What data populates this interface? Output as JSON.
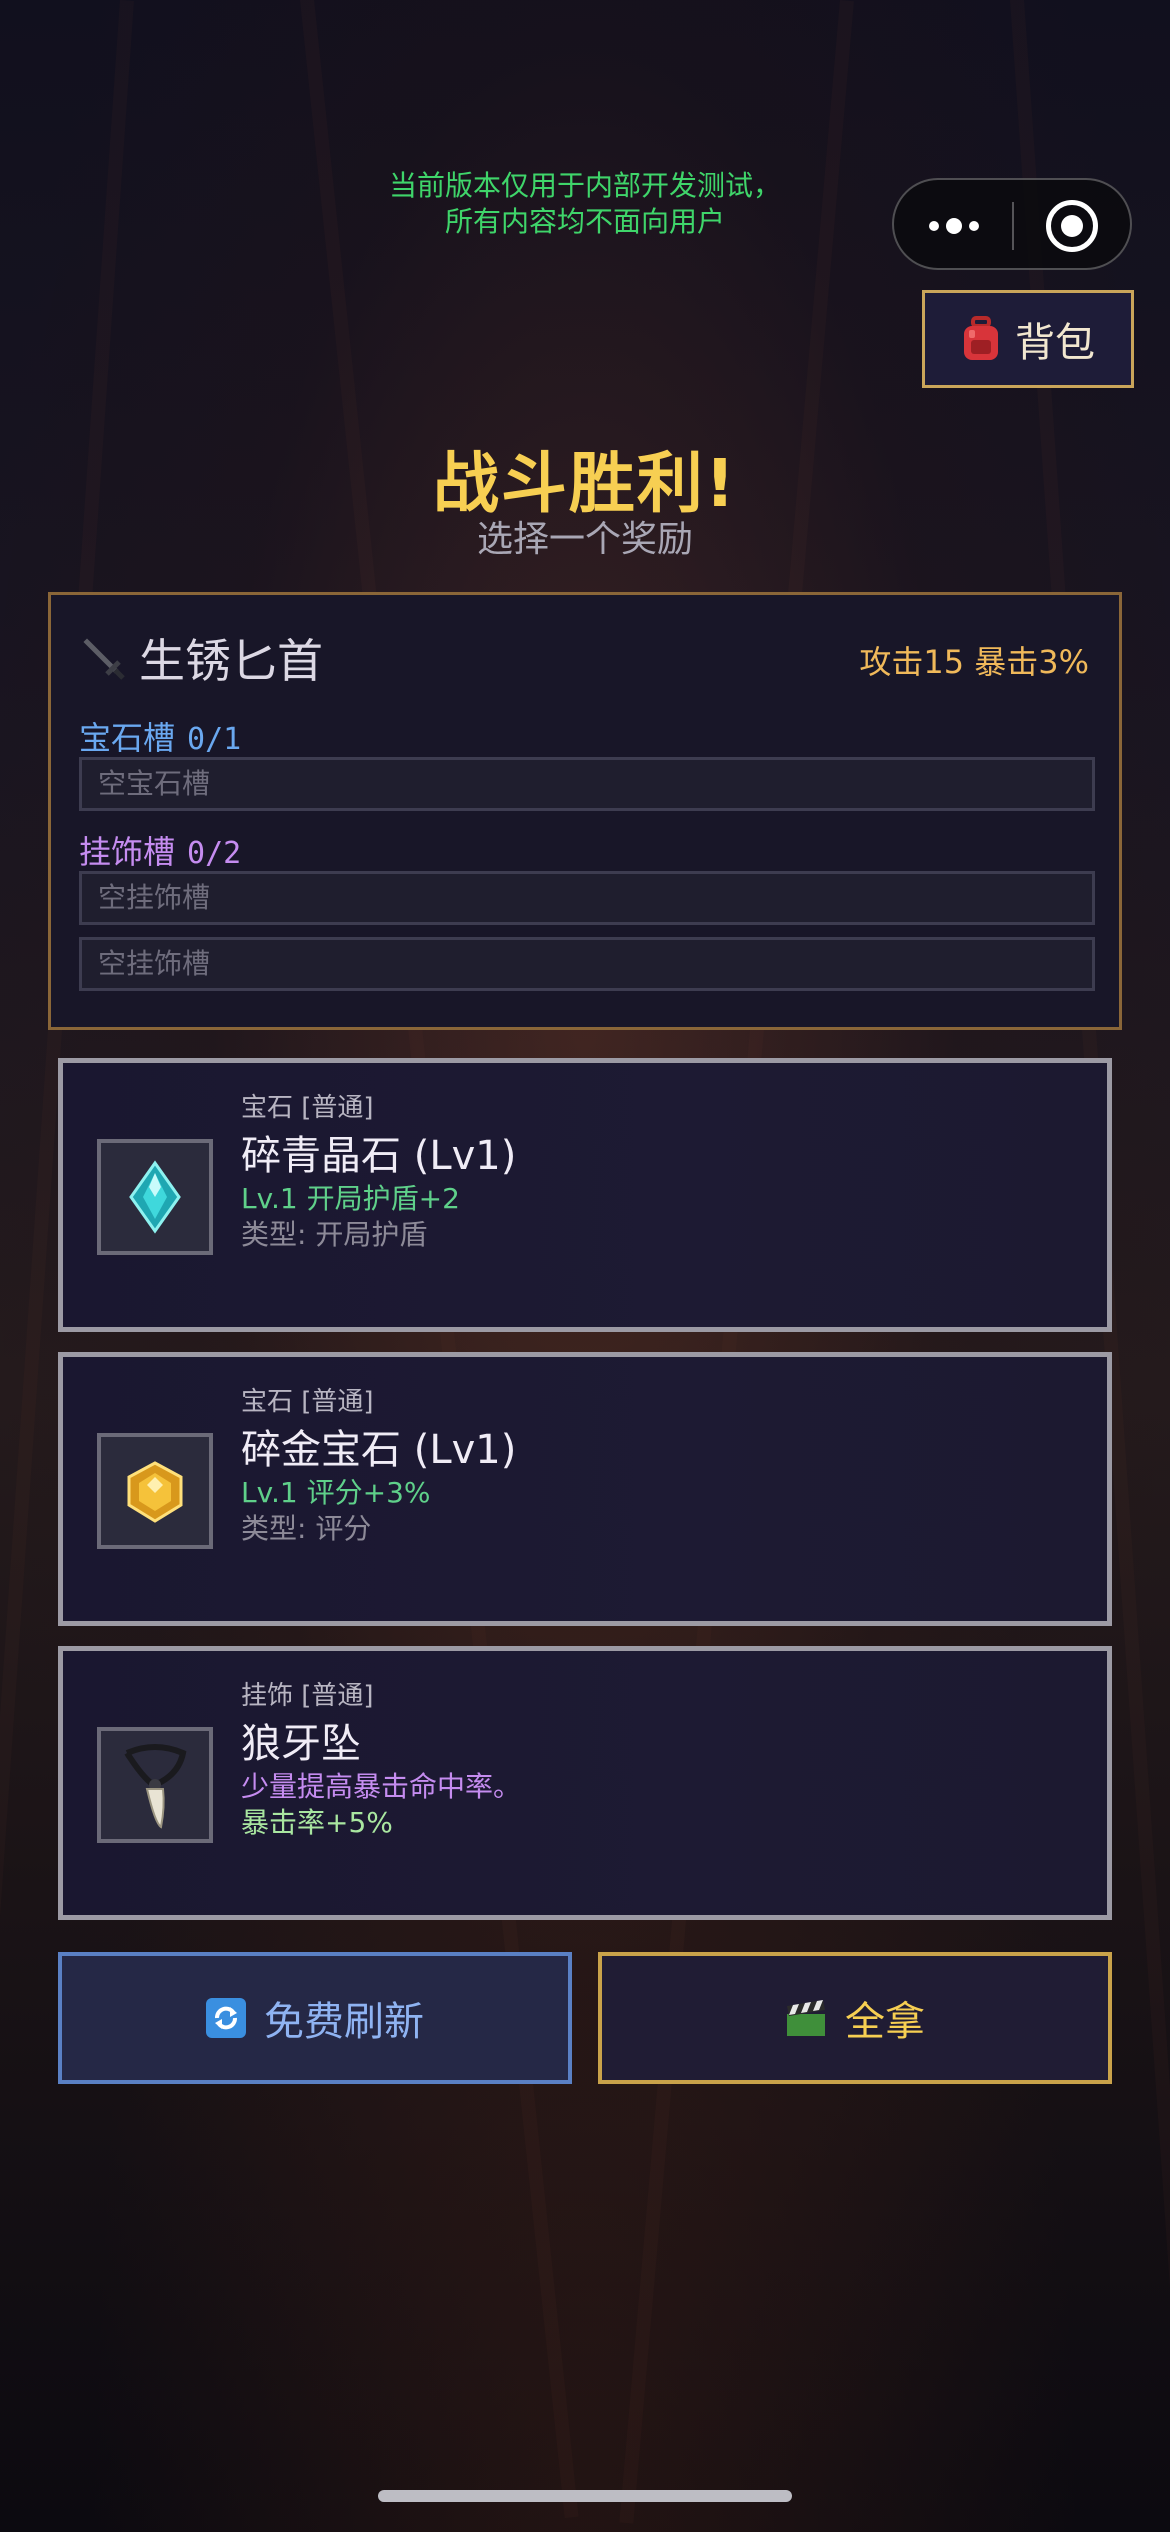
{
  "dev_notice": {
    "line1": "当前版本仅用于内部开发测试，",
    "line2": "所有内容均不面向用户"
  },
  "bag_button": {
    "label": "背包",
    "icon": "backpack-icon"
  },
  "title": "战斗胜利!",
  "subtitle": "选择一个奖励",
  "weapon": {
    "name": "生锈匕首",
    "icon": "dagger-icon",
    "stats": "攻击15 暴击3%",
    "gem_slots": {
      "label": "宝石槽",
      "count": "0/1",
      "slots": [
        "空宝石槽"
      ]
    },
    "charm_slots": {
      "label": "挂饰槽",
      "count": "0/2",
      "slots": [
        "空挂饰槽",
        "空挂饰槽"
      ]
    }
  },
  "rewards": [
    {
      "category": "宝石 [普通]",
      "name": "碎青晶石 (Lv1)",
      "line1": "Lv.1 开局护盾+2",
      "line2": "类型: 开局护盾",
      "icon": "cyan-crystal-icon"
    },
    {
      "category": "宝石 [普通]",
      "name": "碎金宝石 (Lv1)",
      "line1": "Lv.1 评分+3%",
      "line2": "类型: 评分",
      "icon": "gold-gem-icon"
    },
    {
      "category": "挂饰 [普通]",
      "name": "狼牙坠",
      "line1": "少量提高暴击命中率。",
      "line2": "暴击率+5%",
      "icon": "wolf-fang-pendant-icon"
    }
  ],
  "actions": {
    "refresh_label": "免费刷新",
    "take_all_label": "全拿"
  },
  "colors": {
    "title": "#f7cf52",
    "dev_notice": "#3fd56a",
    "gem_slot_label": "#6aa8f0",
    "charm_slot_label": "#c58cf0",
    "stat_green": "#5fd08a",
    "charm_desc_purple": "#c58cf0",
    "charm_stat_green": "#a9e6a0"
  }
}
